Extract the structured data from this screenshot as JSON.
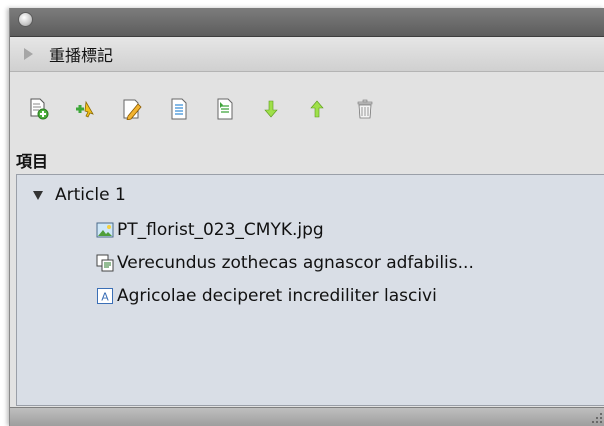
{
  "section": {
    "title": "重播標記",
    "expanded": false
  },
  "toolbar": {
    "tools": [
      {
        "icon": "new-page-add-icon"
      },
      {
        "icon": "add-selection-icon"
      },
      {
        "icon": "edit-pencil-icon"
      },
      {
        "icon": "page-list-icon"
      },
      {
        "icon": "page-replace-icon"
      },
      {
        "icon": "move-down-arrow-icon"
      },
      {
        "icon": "move-up-arrow-icon"
      },
      {
        "icon": "trash-icon"
      }
    ]
  },
  "items_label": "項目",
  "tree": {
    "article": {
      "label": "Article 1",
      "children": [
        {
          "icon": "image-file-icon",
          "label": "PT_florist_023_CMYK.jpg"
        },
        {
          "icon": "linked-text-icon",
          "label": "Verecundus zothecas agnascor adfabilis..."
        },
        {
          "icon": "text-frame-icon",
          "label": "Agricolae deciperet incrediliter lascivi"
        }
      ]
    }
  },
  "colors": {
    "list_bg": "#d9dee6",
    "panel_bg": "#e2e2e2",
    "titlebar": "#6d6d6d"
  }
}
